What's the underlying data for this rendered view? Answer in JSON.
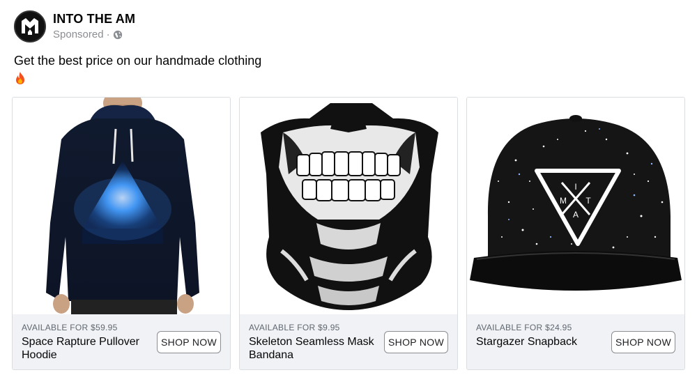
{
  "page": {
    "name": "INTO THE AM",
    "sponsored": "Sponsored",
    "separator": "·"
  },
  "post": {
    "text": "Get the best price on our handmade clothing",
    "emoji_icon": "fire-icon"
  },
  "cards": [
    {
      "price": "AVAILABLE FOR $59.95",
      "title": "Space Rapture Pullover Hoodie",
      "button": "SHOP NOW",
      "image": "hoodie-image"
    },
    {
      "price": "AVAILABLE FOR $9.95",
      "title": "Skeleton Seamless Mask Bandana",
      "button": "SHOP NOW",
      "image": "bandana-image"
    },
    {
      "price": "AVAILABLE FOR $24.95",
      "title": "Stargazer Snapback",
      "button": "SHOP NOW",
      "image": "snapback-image",
      "logo_letters": [
        "I",
        "M",
        "T",
        "A"
      ]
    }
  ],
  "colors": {
    "footer_bg": "#f0f2f5",
    "meta_gray": "#8a8d91",
    "text": "#050505"
  }
}
